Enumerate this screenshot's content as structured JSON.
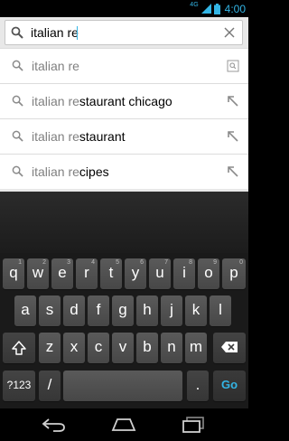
{
  "status_bar": {
    "network": "4G",
    "time": "4:00"
  },
  "search": {
    "query": "italian re",
    "typed_prefix": "italian re"
  },
  "suggestions": [
    {
      "typed": "italian re",
      "completion": "",
      "action_icon": "search-web-icon"
    },
    {
      "typed": "italian re",
      "completion": "staurant chicago",
      "action_icon": "arrow-up-left-icon"
    },
    {
      "typed": "italian re",
      "completion": "staurant",
      "action_icon": "arrow-up-left-icon"
    },
    {
      "typed": "italian re",
      "completion": "cipes",
      "action_icon": "arrow-up-left-icon"
    }
  ],
  "keyboard": {
    "row1": [
      "q",
      "w",
      "e",
      "r",
      "t",
      "y",
      "u",
      "i",
      "o",
      "p"
    ],
    "row1_alt": [
      "1",
      "2",
      "3",
      "4",
      "5",
      "6",
      "7",
      "8",
      "9",
      "0"
    ],
    "row2": [
      "a",
      "s",
      "d",
      "f",
      "g",
      "h",
      "j",
      "k",
      "l"
    ],
    "row3": [
      "z",
      "x",
      "c",
      "v",
      "b",
      "n",
      "m"
    ],
    "symbols_label": "?123",
    "slash": "/",
    "period": ".",
    "go_label": "Go"
  },
  "colors": {
    "accent": "#33b5e5",
    "key": "#4f4f4f",
    "background": "#000000"
  }
}
